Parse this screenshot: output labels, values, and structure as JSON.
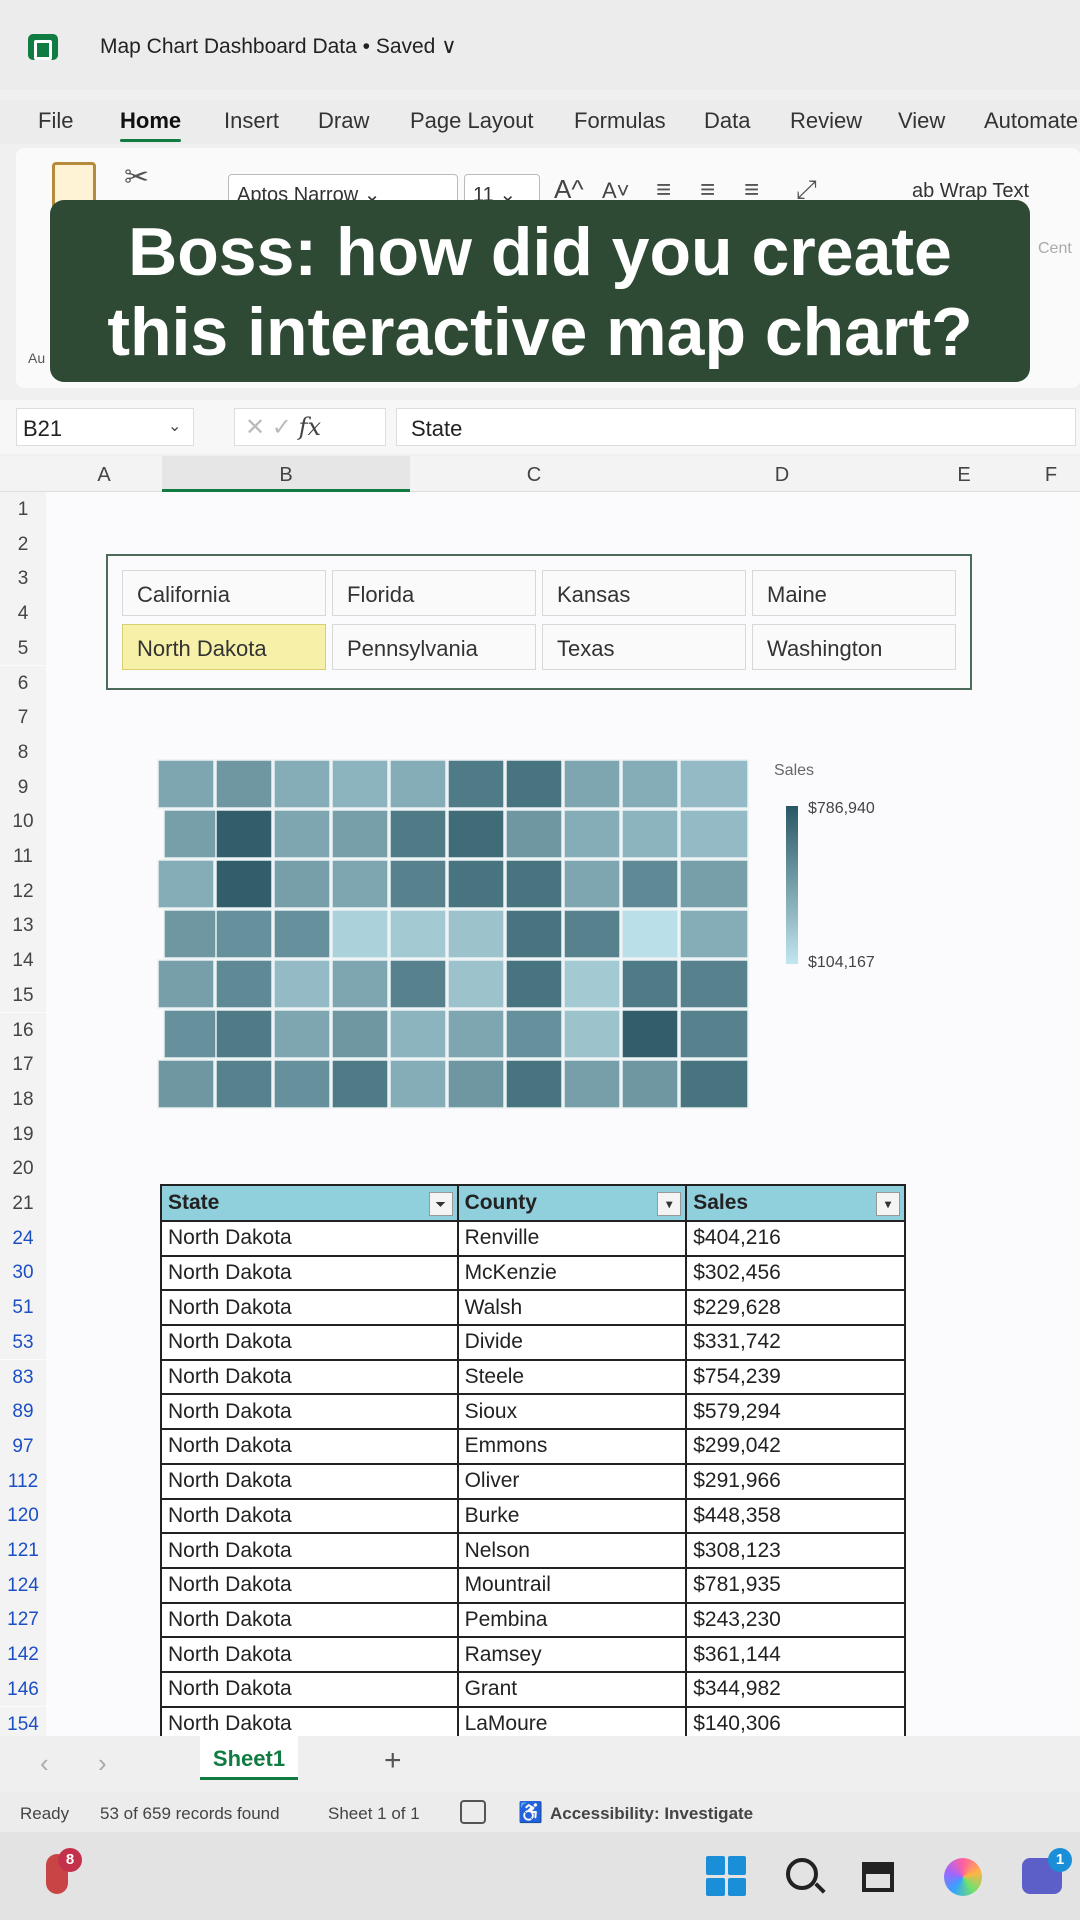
{
  "window": {
    "title": "Map Chart Dashboard Data • Saved ∨"
  },
  "menu": [
    "File",
    "Home",
    "Insert",
    "Draw",
    "Page Layout",
    "Formulas",
    "Data",
    "Review",
    "View",
    "Automate"
  ],
  "ribbon": {
    "font_name": "Aptos Narrow ⌄",
    "font_size": "11 ⌄",
    "grow_font": "A^",
    "shrink_font": "A˅",
    "wrap_text": "ab Wrap Text",
    "auto_label": "Au",
    "center_label": "Cent"
  },
  "caption": {
    "line1": "Boss: how did you create",
    "line2": "this interactive map chart?"
  },
  "formula_bar": {
    "name_box": "B21",
    "fx": "fx",
    "value": "State"
  },
  "columns": [
    "A",
    "B",
    "C",
    "D",
    "E",
    "F"
  ],
  "rows_top": [
    "1",
    "2",
    "3",
    "4",
    "5",
    "6",
    "7",
    "8",
    "9",
    "10",
    "11",
    "12",
    "13",
    "14",
    "15",
    "16",
    "17",
    "18",
    "19",
    "20",
    "21"
  ],
  "rows_filtered": [
    "24",
    "30",
    "51",
    "53",
    "83",
    "89",
    "97",
    "112",
    "120",
    "121",
    "124",
    "127",
    "142",
    "146",
    "154"
  ],
  "slicer": {
    "items": [
      "California",
      "Florida",
      "Kansas",
      "Maine",
      "North Dakota",
      "Pennsylvania",
      "Texas",
      "Washington"
    ],
    "selected": "North Dakota"
  },
  "legend": {
    "title": "Sales",
    "max": "$786,940",
    "min": "$104,167",
    "high_color": "#295763",
    "low_color": "#c2e6ef"
  },
  "table": {
    "headers": [
      "State",
      "County",
      "Sales"
    ],
    "rows": [
      [
        "North Dakota",
        "Renville",
        "$404,216"
      ],
      [
        "North Dakota",
        "McKenzie",
        "$302,456"
      ],
      [
        "North Dakota",
        "Walsh",
        "$229,628"
      ],
      [
        "North Dakota",
        "Divide",
        "$331,742"
      ],
      [
        "North Dakota",
        "Steele",
        "$754,239"
      ],
      [
        "North Dakota",
        "Sioux",
        "$579,294"
      ],
      [
        "North Dakota",
        "Emmons",
        "$299,042"
      ],
      [
        "North Dakota",
        "Oliver",
        "$291,966"
      ],
      [
        "North Dakota",
        "Burke",
        "$448,358"
      ],
      [
        "North Dakota",
        "Nelson",
        "$308,123"
      ],
      [
        "North Dakota",
        "Mountrail",
        "$781,935"
      ],
      [
        "North Dakota",
        "Pembina",
        "$243,230"
      ],
      [
        "North Dakota",
        "Ramsey",
        "$361,144"
      ],
      [
        "North Dakota",
        "Grant",
        "$344,982"
      ],
      [
        "North Dakota",
        "LaMoure",
        "$140,306"
      ]
    ]
  },
  "sheet_tabs": {
    "active": "Sheet1",
    "add": "+"
  },
  "status": {
    "ready": "Ready",
    "records": "53 of 659 records found",
    "sheet": "Sheet 1 of 1",
    "accessibility": "Accessibility: Investigate"
  },
  "taskbar": {
    "weather_badge": "8",
    "teams_badge": "1"
  }
}
